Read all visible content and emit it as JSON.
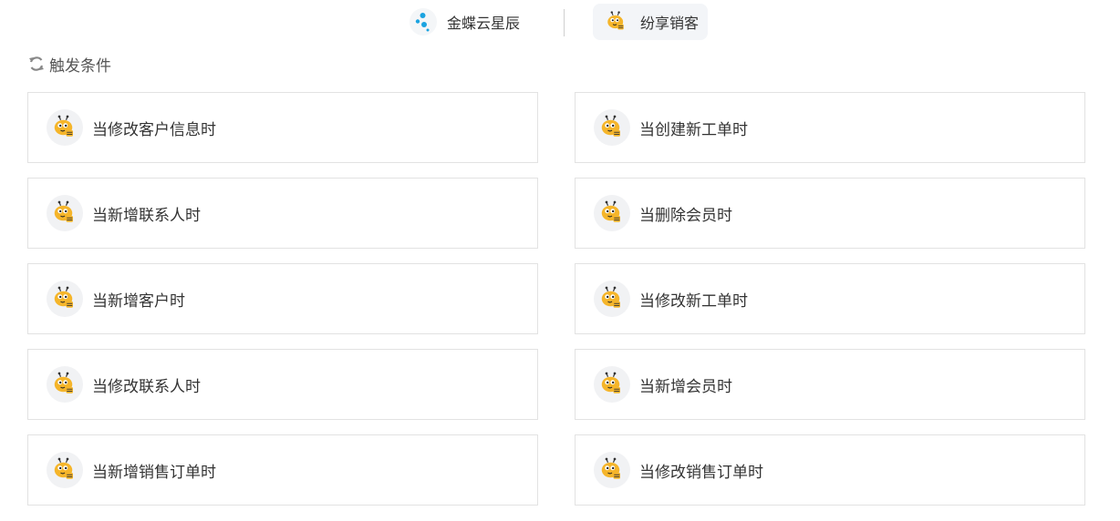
{
  "apps": {
    "left": {
      "name": "金蝶云星辰",
      "icon": "kingdee-dots-icon"
    },
    "right": {
      "name": "纷享销客",
      "icon": "bee-icon"
    }
  },
  "section": {
    "title": "触发条件",
    "icon": "sync-icon"
  },
  "triggers": [
    {
      "label": "当修改客户信息时",
      "icon": "bee-icon"
    },
    {
      "label": "当创建新工单时",
      "icon": "bee-icon"
    },
    {
      "label": "当新增联系人时",
      "icon": "bee-icon"
    },
    {
      "label": "当删除会员时",
      "icon": "bee-icon"
    },
    {
      "label": "当新增客户时",
      "icon": "bee-icon"
    },
    {
      "label": "当修改新工单时",
      "icon": "bee-icon"
    },
    {
      "label": "当修改联系人时",
      "icon": "bee-icon"
    },
    {
      "label": "当新增会员时",
      "icon": "bee-icon"
    },
    {
      "label": "当新增销售订单时",
      "icon": "bee-icon"
    },
    {
      "label": "当修改销售订单时",
      "icon": "bee-icon"
    }
  ],
  "colors": {
    "accent_blue": "#1ba3e0",
    "bee_yellow": "#f5b52a",
    "border": "#e2e2e2"
  }
}
